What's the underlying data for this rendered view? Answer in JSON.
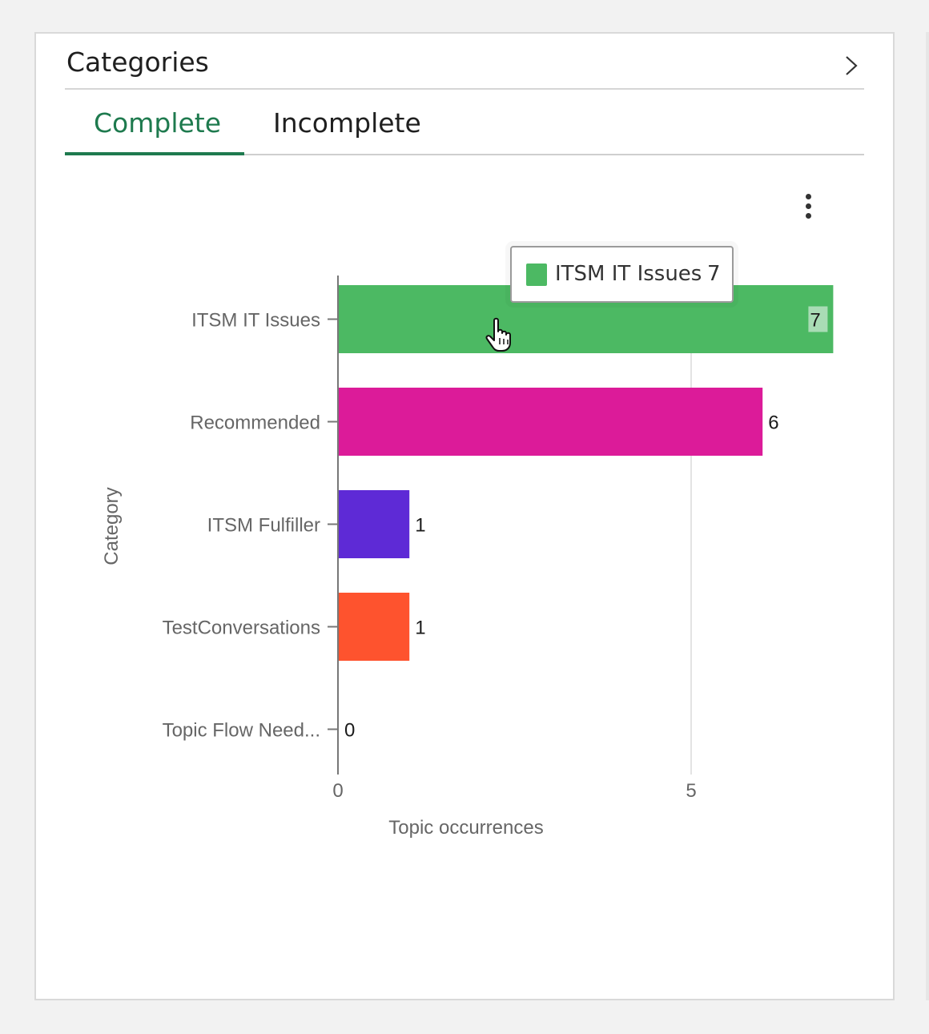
{
  "header": {
    "title": "Categories",
    "chevron_icon": "chevron-right-icon"
  },
  "tabs": [
    {
      "label": "Complete",
      "active": true
    },
    {
      "label": "Incomplete",
      "active": false
    }
  ],
  "menu_icon": "more-vertical-icon",
  "tooltip": {
    "label": "ITSM IT Issues",
    "value": "7",
    "color": "#4cb963"
  },
  "chart_data": {
    "type": "bar",
    "orientation": "horizontal",
    "categories": [
      "ITSM IT Issues",
      "Recommended",
      "ITSM Fulfiller",
      "TestConversations",
      "Topic Flow Need..."
    ],
    "values": [
      7,
      6,
      1,
      1,
      0
    ],
    "colors": [
      "#4cb963",
      "#dc1b99",
      "#5e2ad6",
      "#fe532e",
      "#4cb963"
    ],
    "xlabel": "Topic occurrences",
    "ylabel": "Category",
    "xlim": [
      0,
      7
    ],
    "xticks": [
      0,
      5
    ],
    "grid": true
  }
}
